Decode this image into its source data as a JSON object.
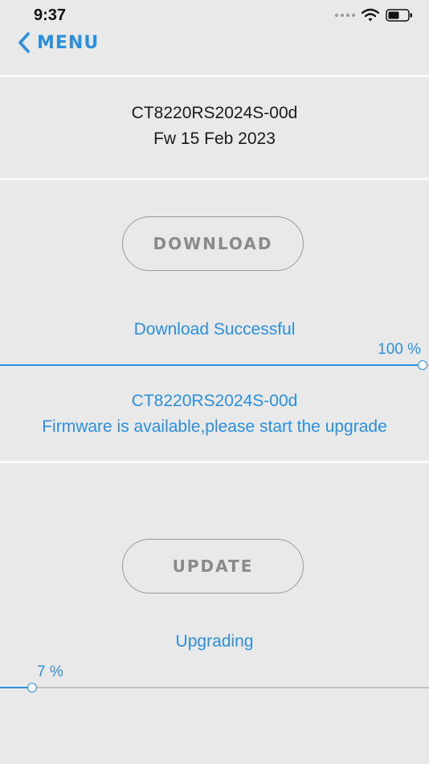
{
  "status_bar": {
    "time": "9:37",
    "icons": [
      "signal-dots-icon",
      "wifi-icon",
      "battery-icon"
    ]
  },
  "nav": {
    "back_label": "MENU"
  },
  "device": {
    "model": "CT8220RS2024S-00d",
    "firmware": "Fw 15 Feb 2023"
  },
  "download": {
    "button_label": "DOWNLOAD",
    "status": "Download Successful",
    "progress_label": "100 %",
    "progress": 1.0
  },
  "firmware_notice": {
    "model": "CT8220RS2024S-00d",
    "message": "Firmware is available,please start the upgrade"
  },
  "update": {
    "button_label": "UPDATE",
    "status": "Upgrading",
    "progress_label": "7 %",
    "progress": 0.07
  },
  "colors": {
    "accent": "#2b8fe0",
    "background": "#e9e9e9",
    "button_text": "#8a8a8a"
  }
}
